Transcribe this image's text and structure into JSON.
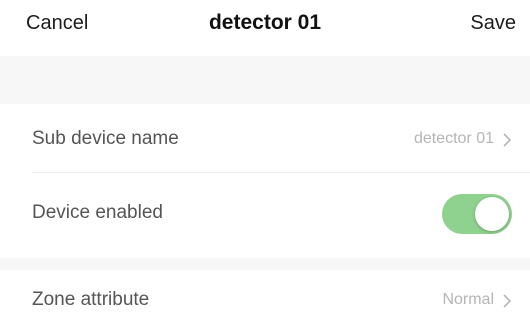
{
  "nav": {
    "cancel_label": "Cancel",
    "title": "detector 01",
    "save_label": "Save"
  },
  "settings": [
    {
      "label": "Sub device name",
      "value": "detector 01"
    },
    {
      "label": "Device enabled",
      "enabled": true
    },
    {
      "label": "Zone attribute",
      "value": "Normal"
    }
  ],
  "colors": {
    "toggle_on": "#8fd18f",
    "section_background": "#f7f7f7",
    "value_text": "#b5b5b5"
  }
}
